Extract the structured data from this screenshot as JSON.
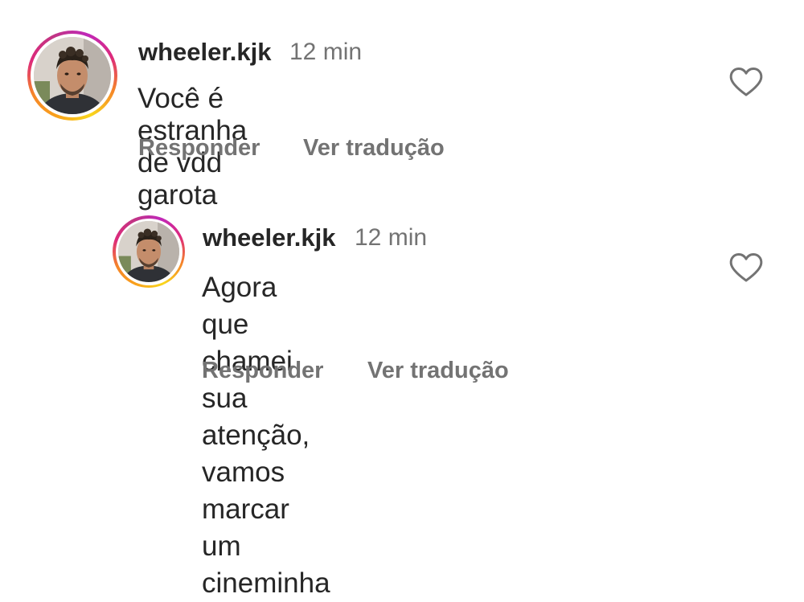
{
  "comments": [
    {
      "username": "wheeler.kjk",
      "time": "12 min",
      "text": "Você é estranha de vdd garota",
      "reply_label": "Responder",
      "translate_label": "Ver tradução",
      "like_icon": "heart-outline-icon",
      "avatar": "profile-photo"
    },
    {
      "username": "wheeler.kjk",
      "time": "12 min",
      "text": "Agora que chamei sua atenção,\nvamos marcar um cineminha",
      "reply_label": "Responder",
      "translate_label": "Ver tradução",
      "like_icon": "heart-outline-icon",
      "avatar": "profile-photo"
    }
  ],
  "colors": {
    "primary_text": "#262626",
    "secondary_text": "#737373",
    "background": "#ffffff",
    "story_ring": [
      "#f9d71c",
      "#f58529",
      "#dd2a7b",
      "#c13584"
    ]
  }
}
